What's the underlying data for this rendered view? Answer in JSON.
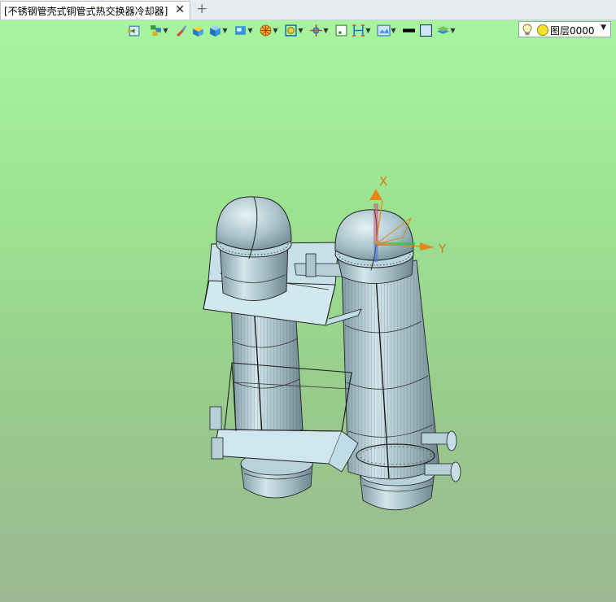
{
  "tabs": {
    "active_title": "[不锈钢管壳式铜管式热交换器冷却器]",
    "close_glyph": "✕",
    "new_tab_glyph": "+"
  },
  "toolbar": {
    "icons": [
      "view-orient-icon",
      "view-layers-icon",
      "brush-icon",
      "box-render-icon",
      "cube-icon",
      "display-mode-icon",
      "section-icon",
      "zoom-fit-icon",
      "pan-icon",
      "snap-icon",
      "measure-icon",
      "render-settings-icon",
      "line-color-icon",
      "fill-icon",
      "layer-manager-icon"
    ],
    "colors": {
      "accent_blue": "#1a78c2",
      "line_black": "#000000"
    }
  },
  "layer": {
    "value": "图层0000"
  },
  "viewport": {
    "background_top": "#a8f7a0",
    "background_bottom": "#9cb893",
    "model_color": "#b8d8e2",
    "axes": {
      "x_label": "X",
      "y_label": "Y"
    }
  }
}
